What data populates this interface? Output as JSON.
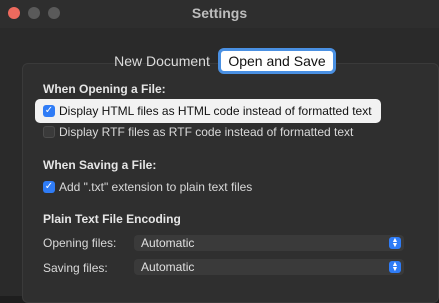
{
  "window": {
    "title": "Settings"
  },
  "tabs": [
    {
      "label": "New Document"
    },
    {
      "label": "Open and Save"
    }
  ],
  "opening": {
    "heading": "When Opening a File:",
    "options": [
      {
        "label": "Display HTML files as HTML code instead of formatted text",
        "checked": true
      },
      {
        "label": "Display RTF files as RTF code instead of formatted text",
        "checked": false
      }
    ]
  },
  "saving": {
    "heading": "When Saving a File:",
    "options": [
      {
        "label": "Add \".txt\" extension to plain text files",
        "checked": true
      }
    ]
  },
  "encoding": {
    "heading": "Plain Text File Encoding",
    "opening_label": "Opening files:",
    "opening_value": "Automatic",
    "saving_label": "Saving files:",
    "saving_value": "Automatic"
  },
  "colors": {
    "accent": "#2f7cf6",
    "close": "#ed6a5e"
  }
}
